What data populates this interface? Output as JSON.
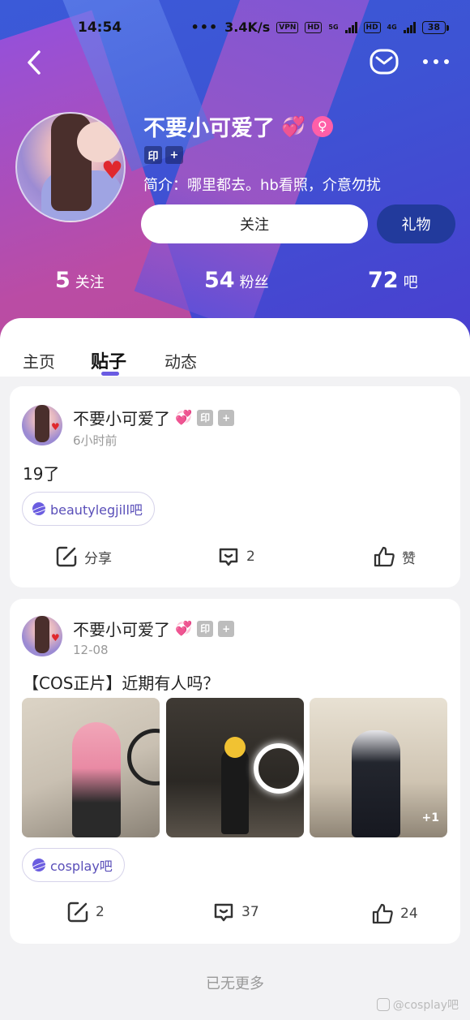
{
  "status": {
    "time": "14:54",
    "speed": "3.4K/s",
    "vpn": "VPN",
    "hd1": "HD",
    "net1": "5G",
    "hd2": "HD",
    "net2": "4G",
    "battery": "38"
  },
  "header": {
    "name": "不要小可爱了",
    "name_emoji": "💞",
    "badge_yin": "印",
    "badge_plus": "+",
    "bio": "简介：哪里都去。hb看照，介意勿扰",
    "follow_label": "关注",
    "gift_label": "礼物"
  },
  "stats": [
    {
      "value": "5",
      "label": "关注"
    },
    {
      "value": "54",
      "label": "粉丝"
    },
    {
      "value": "72",
      "label": "吧"
    }
  ],
  "tabs": [
    {
      "label": "主页"
    },
    {
      "label": "贴子"
    },
    {
      "label": "动态"
    }
  ],
  "posts": [
    {
      "author": "不要小可爱了",
      "emoji": "💞",
      "badge_yin": "印",
      "badge_plus": "+",
      "time": "6小时前",
      "text": "19了",
      "tieba": "beautylegjill吧",
      "share": "分享",
      "comments": "2",
      "likes": "赞"
    },
    {
      "author": "不要小可爱了",
      "emoji": "💞",
      "badge_yin": "印",
      "badge_plus": "+",
      "time": "12-08",
      "text": "【COS正片】近期有人吗？",
      "more_images": "+1",
      "tieba": "cosplay吧",
      "share": "2",
      "comments": "37",
      "likes": "24"
    }
  ],
  "footer": {
    "no_more": "已无更多",
    "watermark": "@cosplay吧"
  },
  "colors": {
    "header_blue": "#3d54d4",
    "accent_purple": "#6a5be2",
    "gift_button": "#223a9c"
  }
}
